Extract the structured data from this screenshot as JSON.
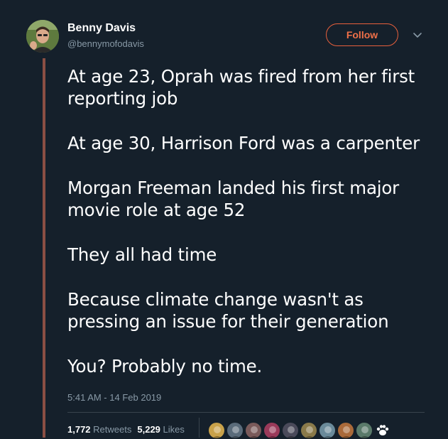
{
  "user": {
    "name": "Benny Davis",
    "handle": "@bennymofodavis",
    "follow_label": "Follow"
  },
  "tweet": {
    "paragraphs": [
      "At age 23, Oprah was fired from her first reporting job",
      "At age 30, Harrison Ford was a carpenter",
      "Morgan Freeman landed his first major movie role at age 52",
      "They all had time",
      "Because climate change wasn't as pressing an issue for their generation",
      "You? Probably no time."
    ],
    "timestamp": "5:41 AM - 14 Feb 2019"
  },
  "stats": {
    "retweets_count": "1,772",
    "retweets_label": "Retweets",
    "likes_count": "5,229",
    "likes_label": "Likes"
  },
  "likers": [
    {
      "icon": "avatar",
      "color": "#c9a24a"
    },
    {
      "icon": "avatar",
      "color": "#5a6b7a"
    },
    {
      "icon": "avatar",
      "color": "#7a5a5a"
    },
    {
      "icon": "avatar",
      "color": "#9a3a5a"
    },
    {
      "icon": "avatar",
      "color": "#4a4a5a"
    },
    {
      "icon": "avatar",
      "color": "#8a7a4a"
    },
    {
      "icon": "avatar",
      "color": "#6a8a9a"
    },
    {
      "icon": "avatar",
      "color": "#aa6a3a"
    },
    {
      "icon": "avatar",
      "color": "#5a7a6a"
    },
    {
      "icon": "paw-icon",
      "color": "#ffffff"
    }
  ],
  "colors": {
    "background": "#15202b",
    "accent": "#e8603c",
    "thread_line": "#8b4f44",
    "muted_text": "#8899a6"
  }
}
